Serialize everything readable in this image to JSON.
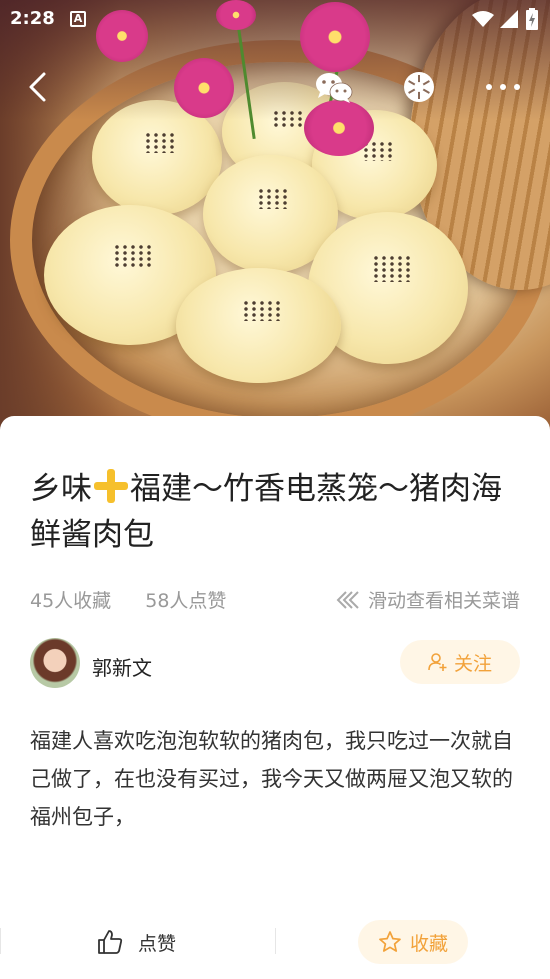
{
  "status_bar": {
    "time": "2:28",
    "notification_icon": "A"
  },
  "hero": {
    "image_alt": "steamed-pork-buns-in-bamboo-steamer"
  },
  "top_actions": {
    "back_icon": "back-icon",
    "wechat_icon": "wechat-icon",
    "moments_icon": "moments-icon",
    "more_icon": "more-icon"
  },
  "recipe": {
    "title_part1": "乡味",
    "title_part2": "福建～竹香电蒸笼～猪肉海鲜酱肉包",
    "favorites_count": "45人收藏",
    "likes_count": "58人点赞",
    "swipe_hint": "滑动查看相关菜谱",
    "description": "福建人喜欢吃泡泡软软的猪肉包，我只吃过一次就自己做了，在也没有买过，我今天又做两屉又泡又软的福州包子，"
  },
  "author": {
    "name": "郭新文",
    "follow_label": "关注"
  },
  "bottom_bar": {
    "like_label": "点赞",
    "collect_label": "收藏"
  },
  "colors": {
    "accent": "#f2a23a",
    "accent_bg": "#fff6e6",
    "muted_text": "#999999"
  }
}
